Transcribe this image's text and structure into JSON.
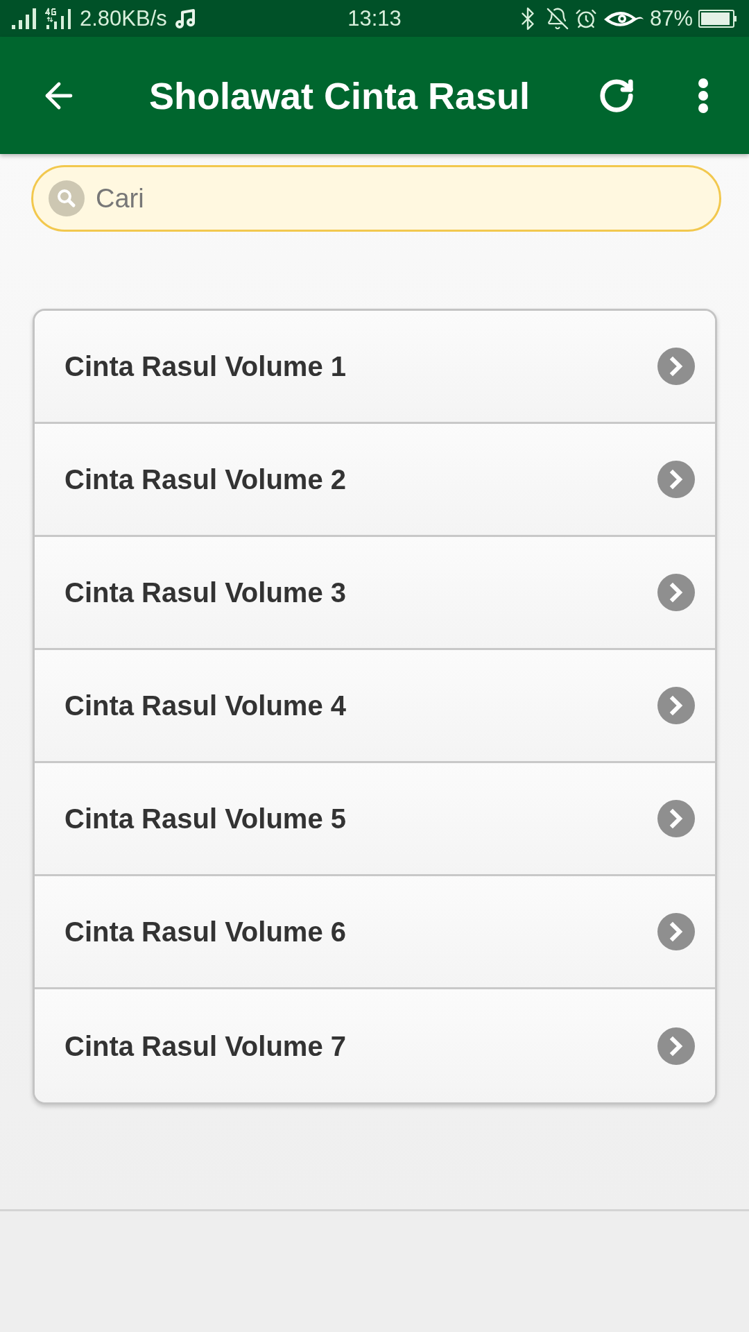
{
  "status_bar": {
    "network_speed": "2.80KB/s",
    "time": "13:13",
    "battery": "87%"
  },
  "app_bar": {
    "title": "Sholawat Cinta Rasul"
  },
  "search": {
    "placeholder": "Cari"
  },
  "items": [
    {
      "label": "Cinta Rasul Volume 1"
    },
    {
      "label": "Cinta Rasul Volume 2"
    },
    {
      "label": "Cinta Rasul Volume 3"
    },
    {
      "label": "Cinta Rasul Volume 4"
    },
    {
      "label": "Cinta Rasul Volume 5"
    },
    {
      "label": "Cinta Rasul Volume 6"
    },
    {
      "label": "Cinta Rasul Volume 7"
    }
  ]
}
